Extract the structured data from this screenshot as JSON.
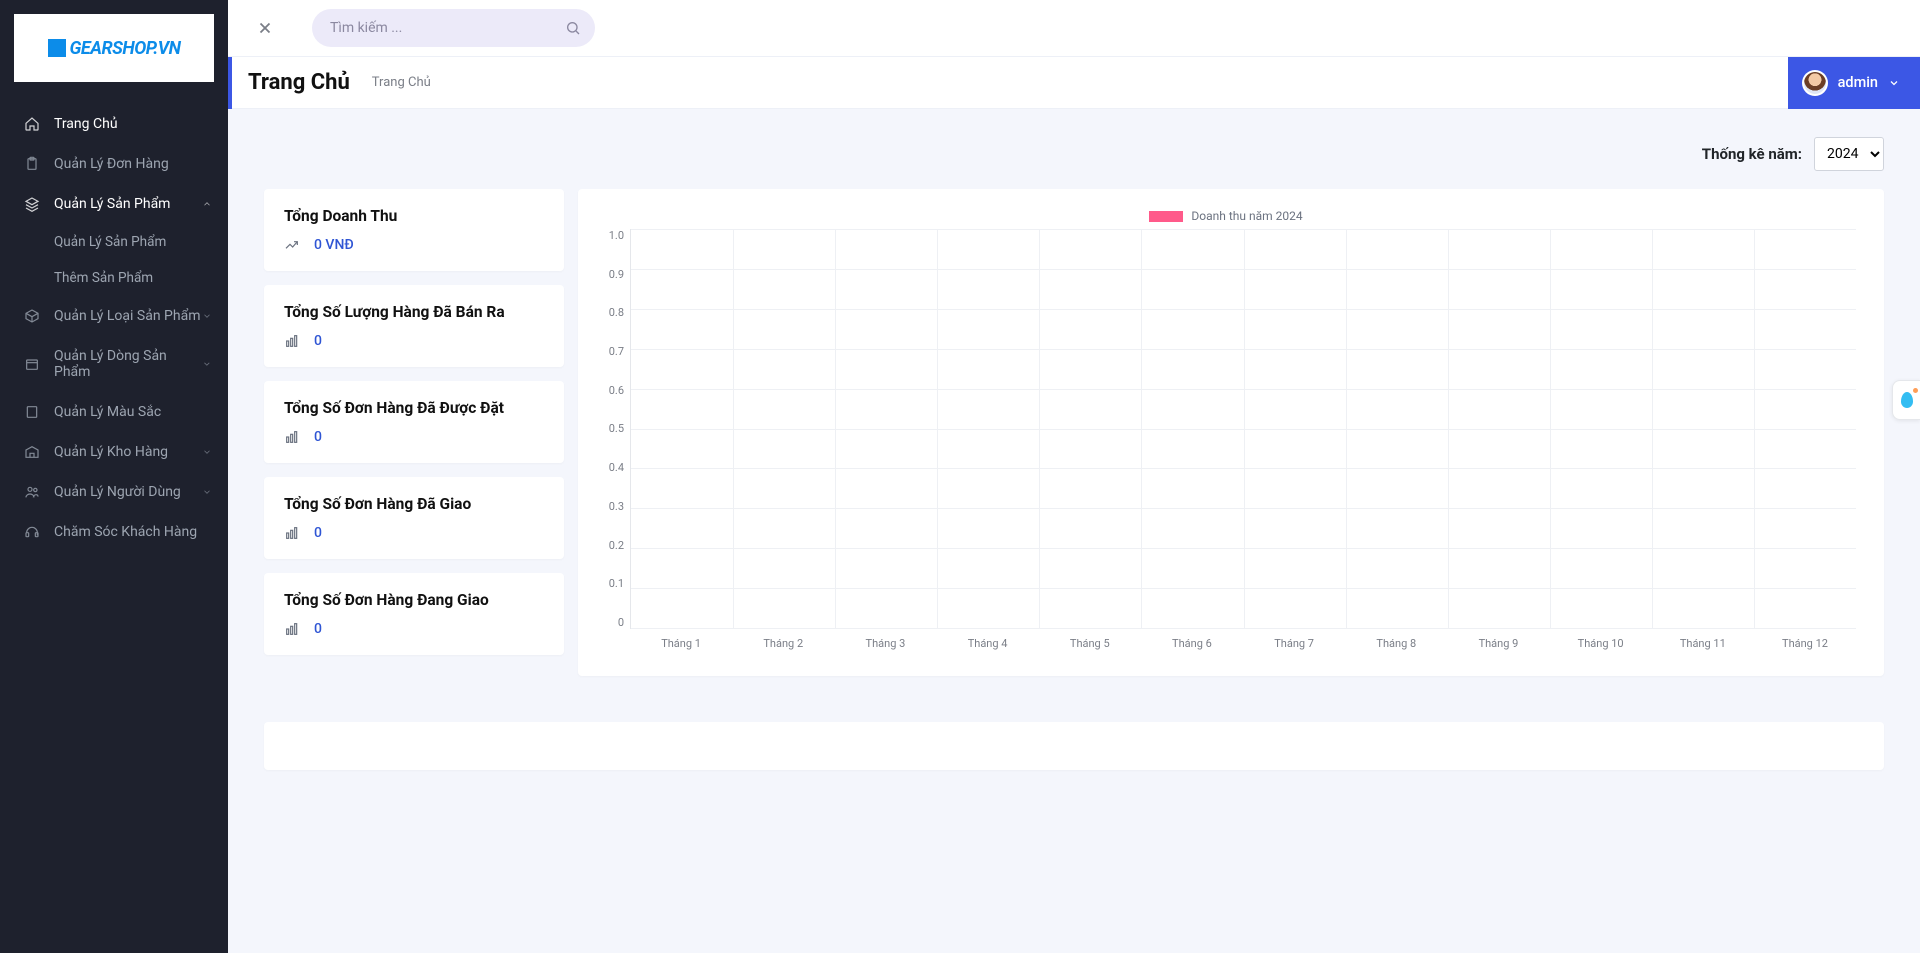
{
  "logo": {
    "text": "GEARSHOP.VN"
  },
  "search": {
    "placeholder": "Tìm kiếm ..."
  },
  "header": {
    "title": "Trang Chủ",
    "breadcrumb": "Trang Chủ",
    "user": "admin"
  },
  "stats_filter": {
    "label": "Thống kê năm:",
    "year": "2024"
  },
  "sidebar": [
    {
      "label": "Trang Chủ",
      "icon": "home-icon",
      "active": true
    },
    {
      "label": "Quản Lý Đơn Hàng",
      "icon": "clipboard-icon"
    },
    {
      "label": "Quản Lý Sản Phẩm",
      "icon": "layers-icon",
      "open": true,
      "chev": "up",
      "children": [
        {
          "label": "Quản Lý Sản Phẩm"
        },
        {
          "label": "Thêm Sản Phẩm"
        }
      ]
    },
    {
      "label": "Quản Lý Loại Sản Phẩm",
      "icon": "box-icon",
      "chev": "down"
    },
    {
      "label": "Quản Lý Dòng Sản Phẩm",
      "icon": "package-icon",
      "chev": "down"
    },
    {
      "label": "Quản Lý Màu Sắc",
      "icon": "color-icon"
    },
    {
      "label": "Quản Lý Kho Hàng",
      "icon": "warehouse-icon",
      "chev": "down"
    },
    {
      "label": "Quản Lý Người Dùng",
      "icon": "users-icon",
      "chev": "down"
    },
    {
      "label": "Chăm Sóc Khách Hàng",
      "icon": "headset-icon"
    }
  ],
  "cards": [
    {
      "title": "Tổng Doanh Thu",
      "icon": "trend-icon",
      "value": "0 VNĐ"
    },
    {
      "title": "Tổng Số Lượng Hàng Đã Bán Ra",
      "icon": "bar-icon",
      "value": "0"
    },
    {
      "title": "Tổng Số Đơn Hàng Đã Được Đặt",
      "icon": "bar-icon",
      "value": "0"
    },
    {
      "title": "Tổng Số Đơn Hàng Đã Giao",
      "icon": "bar-icon",
      "value": "0"
    },
    {
      "title": "Tổng Số Đơn Hàng Đang Giao",
      "icon": "bar-icon",
      "value": "0"
    }
  ],
  "chart_data": {
    "type": "bar",
    "legend": "Doanh thu năm 2024",
    "categories": [
      "Tháng 1",
      "Tháng 2",
      "Tháng 3",
      "Tháng 4",
      "Tháng 5",
      "Tháng 6",
      "Tháng 7",
      "Tháng 8",
      "Tháng 9",
      "Tháng 10",
      "Tháng 11",
      "Tháng 12"
    ],
    "values": [
      0,
      0,
      0,
      0,
      0,
      0,
      0,
      0,
      0,
      0,
      0,
      0
    ],
    "ylim": [
      0,
      1.0
    ],
    "yticks": [
      "1.0",
      "0.9",
      "0.8",
      "0.7",
      "0.6",
      "0.5",
      "0.4",
      "0.3",
      "0.2",
      "0.1",
      "0"
    ],
    "color": "#ff5a8a"
  }
}
